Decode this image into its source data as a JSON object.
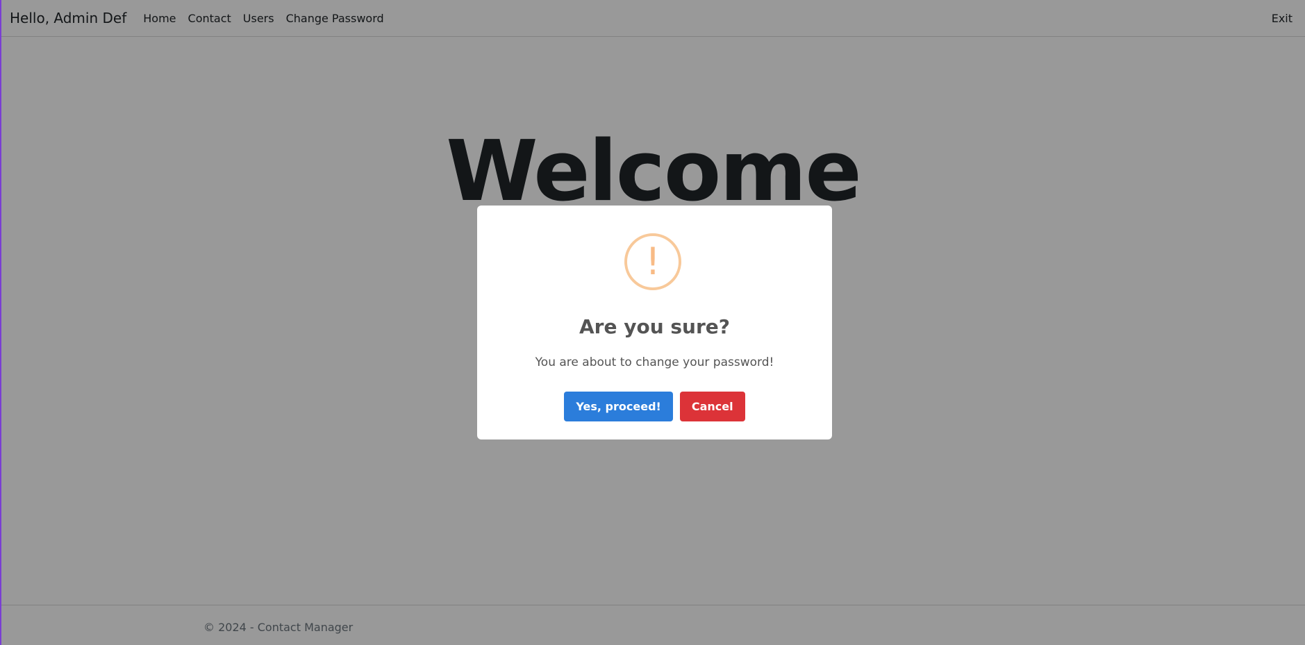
{
  "navbar": {
    "brand": "Hello, Admin Def",
    "links": [
      "Home",
      "Contact",
      "Users",
      "Change Password"
    ],
    "exit": "Exit"
  },
  "main": {
    "heading": "Welcome"
  },
  "footer": {
    "text": "© 2024 - Contact Manager"
  },
  "dialog": {
    "icon": "warning-exclamation-icon",
    "icon_glyph": "!",
    "title": "Are you sure?",
    "message": "You are about to change your password!",
    "confirm_label": "Yes, proceed!",
    "cancel_label": "Cancel",
    "colors": {
      "confirm": "#2b7ddb",
      "cancel": "#dc3338",
      "icon": "#f8bb86"
    }
  }
}
